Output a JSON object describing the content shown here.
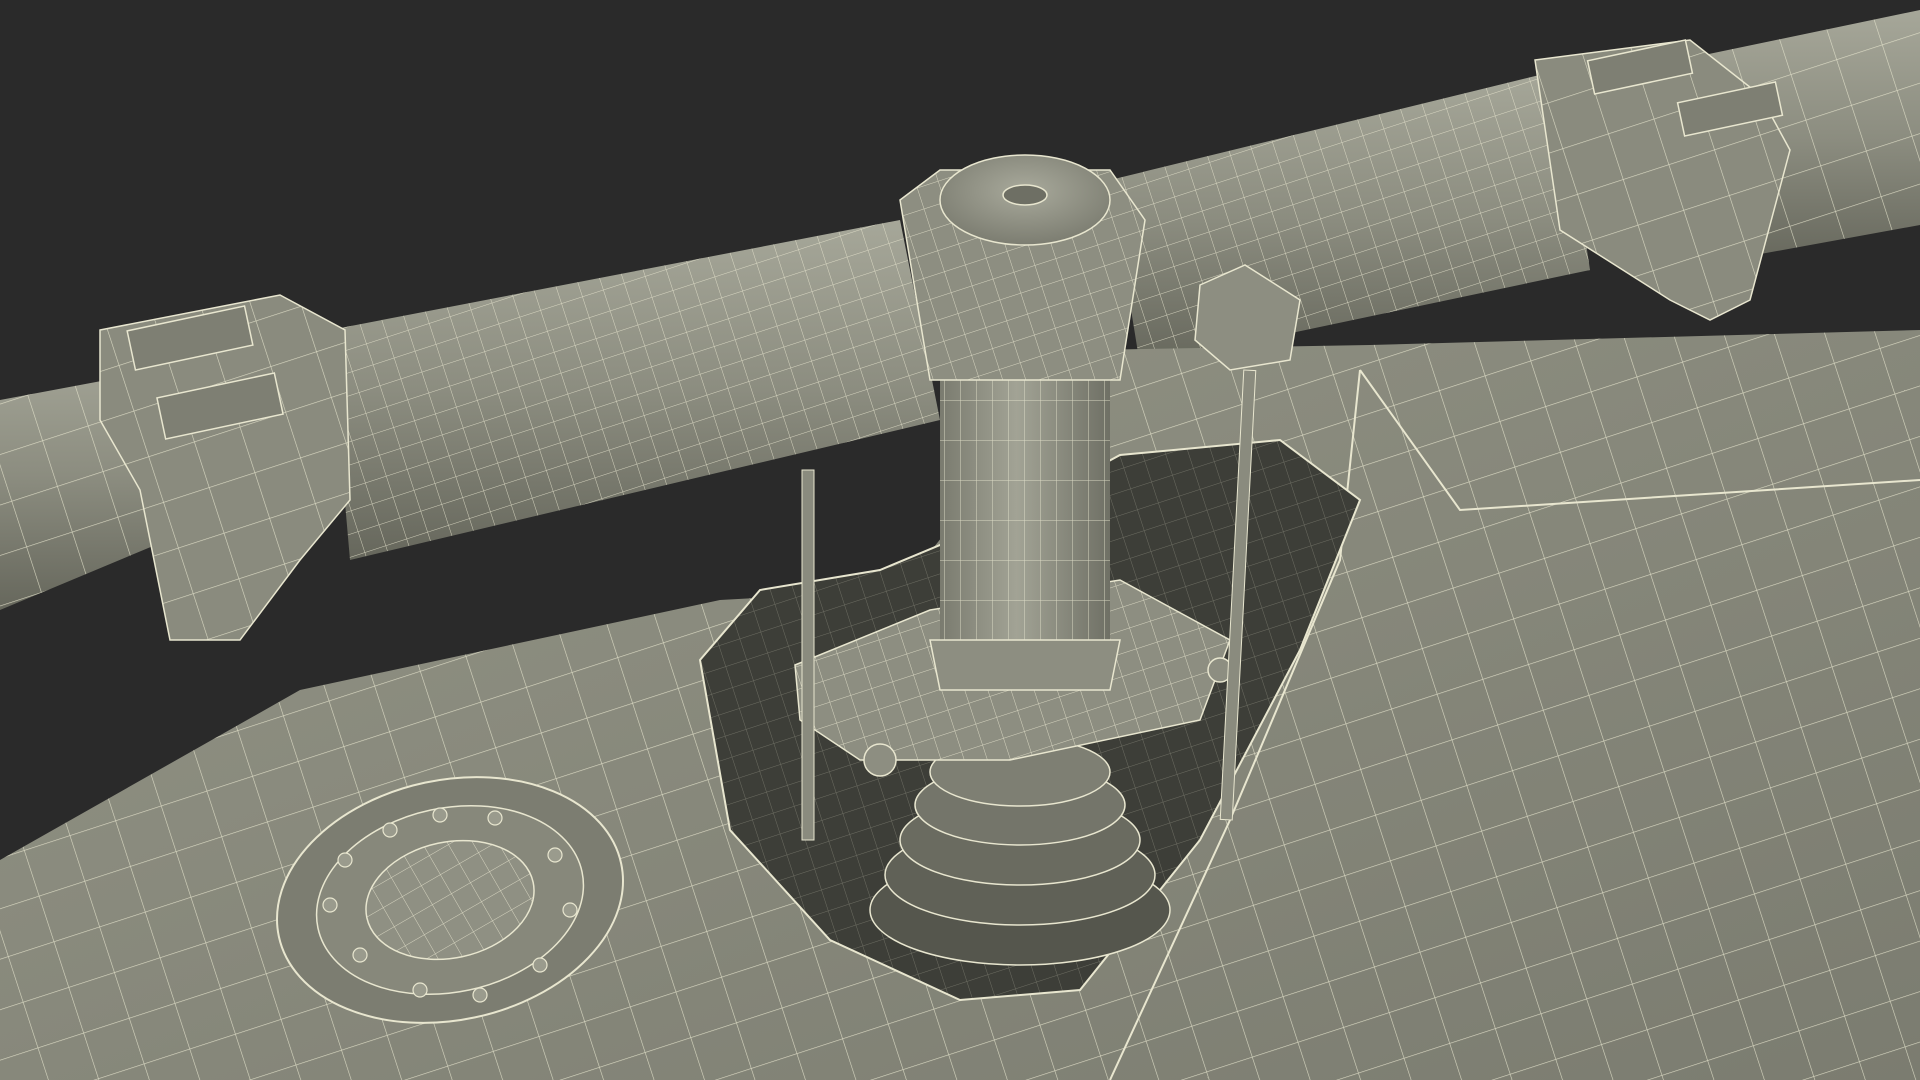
{
  "scene": {
    "subject": "rotor-hub-wireframe-render",
    "colors": {
      "background": "#2a2a2a",
      "surface": "#8a8b7e",
      "surface_dark": "#5e5f55",
      "surface_light": "#a3a496",
      "cavity": "#3d3e38",
      "wire": "#e8e6cf"
    }
  }
}
